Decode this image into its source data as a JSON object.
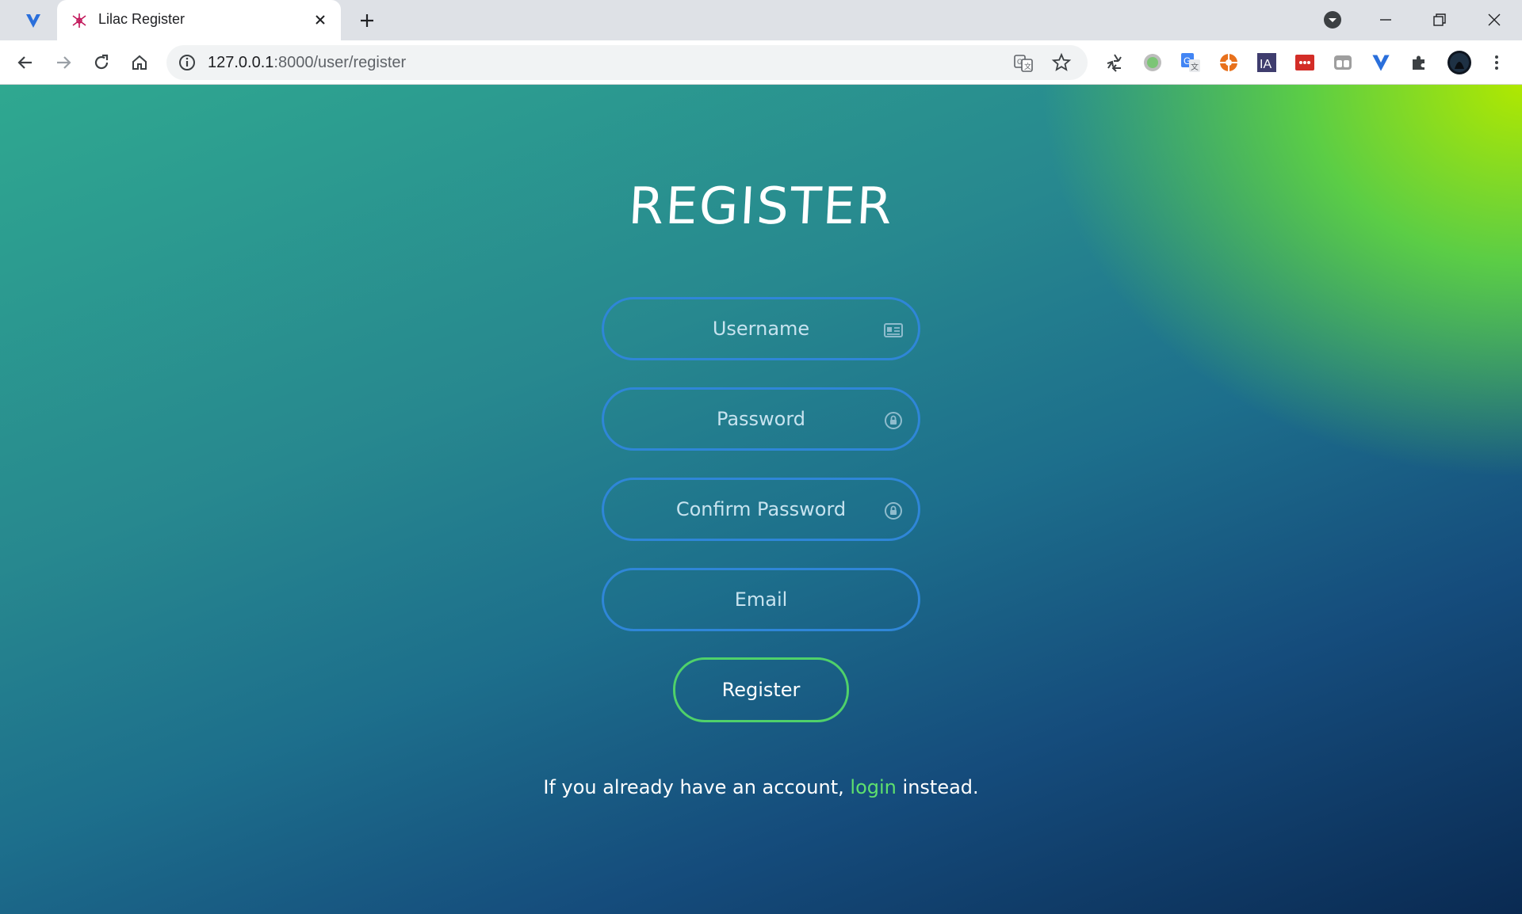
{
  "browser": {
    "tab_title": "Lilac Register",
    "url_host": "127.0.0.1",
    "url_rest": ":8000/user/register"
  },
  "page": {
    "title": "REGISTER",
    "fields": {
      "username_placeholder": "Username",
      "password_placeholder": "Password",
      "confirm_placeholder": "Confirm Password",
      "email_placeholder": "Email"
    },
    "register_label": "Register",
    "footer": {
      "prefix": "If you already have an account,",
      "link": "login",
      "suffix": "instead."
    }
  },
  "colors": {
    "field_border": "#2f86d8",
    "button_border": "#4fd16a",
    "link": "#5ee06e"
  },
  "icons": [
    "vivaldi-icon",
    "tab-favicon",
    "close-icon",
    "plus-icon",
    "back-icon",
    "forward-icon",
    "reload-icon",
    "home-icon",
    "info-icon",
    "translate-icon",
    "star-icon",
    "extensions-icon",
    "menu-icon",
    "id-card-icon",
    "lock-icon"
  ]
}
